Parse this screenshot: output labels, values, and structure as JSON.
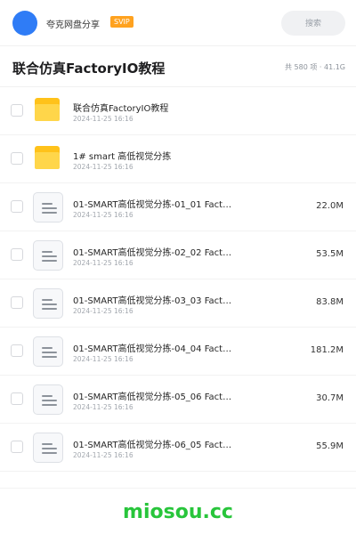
{
  "header": {
    "app_name": "夸克网盘分享",
    "badge": "SVIP",
    "search_label": "搜索",
    "avatar_color": "#2f7cf6",
    "badge_color": "#ffa21f"
  },
  "title": {
    "text": "联合仿真FactoryIO教程",
    "summary": "共 580 项 · 41.1G"
  },
  "files": [
    {
      "type": "folder",
      "icon": "folder-icon",
      "name": "联合仿真FactoryIO教程",
      "date": "2024-11-25 16:16",
      "size": ""
    },
    {
      "type": "folder",
      "icon": "folder-icon",
      "name": "1# smart 高低视觉分拣",
      "date": "2024-11-25 16:16",
      "size": ""
    },
    {
      "type": "file",
      "icon": "document-icon",
      "name": "01-SMART高低视觉分拣-01_01 Fact…",
      "date": "2024-11-25 16:16",
      "size": "22.0M"
    },
    {
      "type": "file",
      "icon": "document-icon",
      "name": "01-SMART高低视觉分拣-02_02 Fact…",
      "date": "2024-11-25 16:16",
      "size": "53.5M"
    },
    {
      "type": "file",
      "icon": "document-icon",
      "name": "01-SMART高低视觉分拣-03_03 Fact…",
      "date": "2024-11-25 16:16",
      "size": "83.8M"
    },
    {
      "type": "file",
      "icon": "document-icon",
      "name": "01-SMART高低视觉分拣-04_04 Fact…",
      "date": "2024-11-25 16:16",
      "size": "181.2M"
    },
    {
      "type": "file",
      "icon": "document-icon",
      "name": "01-SMART高低视觉分拣-05_06 Fact…",
      "date": "2024-11-25 16:16",
      "size": "30.7M"
    },
    {
      "type": "file",
      "icon": "document-icon",
      "name": "01-SMART高低视觉分拣-06_05 Fact…",
      "date": "2024-11-25 16:16",
      "size": "55.9M"
    }
  ],
  "footer": {
    "brand": "miosou.cc",
    "brand_color": "#28c53b"
  }
}
